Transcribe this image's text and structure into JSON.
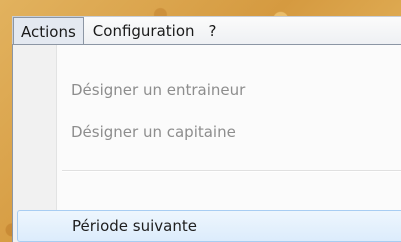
{
  "menubar": {
    "items": [
      {
        "label": "Actions"
      },
      {
        "label": "Configuration"
      },
      {
        "label": "?"
      }
    ]
  },
  "dropdown": {
    "items": [
      {
        "label": "Désigner un entraineur",
        "enabled": false
      },
      {
        "label": "Désigner un capitaine",
        "enabled": false
      },
      {
        "label": "Période suivante",
        "enabled": true,
        "highlighted": true
      }
    ]
  }
}
